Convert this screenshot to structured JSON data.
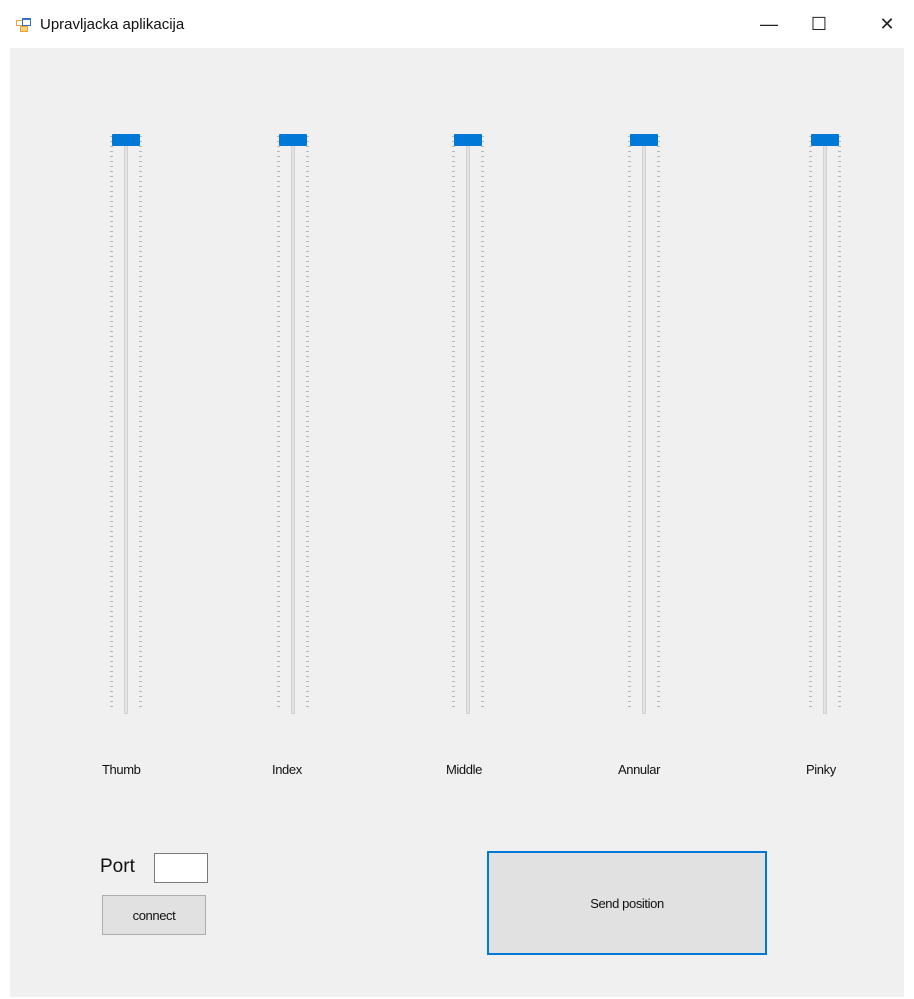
{
  "window": {
    "title": "Upravljacka aplikacija",
    "icon": "app-form-icon",
    "controls": {
      "minimize": "—",
      "maximize": "☐",
      "close": "✕"
    }
  },
  "accent_color": "#0078d7",
  "sliders": [
    {
      "label": "Thumb",
      "value_fraction": 1.0
    },
    {
      "label": "Index",
      "value_fraction": 1.0
    },
    {
      "label": "Middle",
      "value_fraction": 1.0
    },
    {
      "label": "Annular",
      "value_fraction": 1.0
    },
    {
      "label": "Pinky",
      "value_fraction": 1.0
    }
  ],
  "port": {
    "label": "Port",
    "value": ""
  },
  "connect_label": "connect",
  "send_label": "Send position"
}
